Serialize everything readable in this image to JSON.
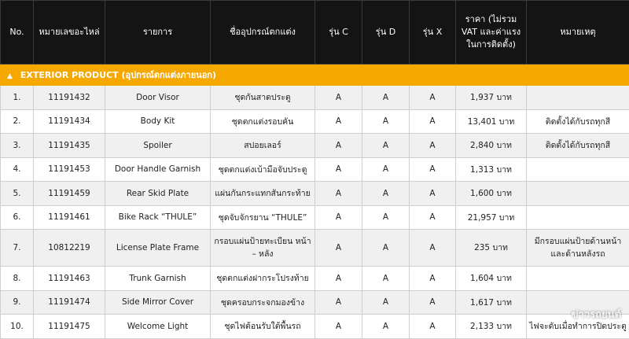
{
  "headers": {
    "no": "No.",
    "part_no": "หมายเลขอะไหล่",
    "item": "รายการ",
    "device": "ชื่ออุปกรณ์ตกแต่ง",
    "model_c": "รุ่น C",
    "model_d": "รุ่น D",
    "model_x": "รุ่น X",
    "price": "ราคา (ไม่รวม VAT และค่าแรง ในการติดตั้ง)",
    "note": "หมายเหตุ"
  },
  "section": {
    "icon": "triangle-up-icon",
    "title": "EXTERIOR PRODUCT (อุปกรณ์ตกแต่งภายนอก)"
  },
  "rows": [
    {
      "no": "1.",
      "part": "11191432",
      "item": "Door Visor",
      "device": "ชุดกันสาดประตู",
      "c": "A",
      "d": "A",
      "x": "A",
      "price": "1,937 บาท",
      "note": ""
    },
    {
      "no": "2.",
      "part": "11191434",
      "item": "Body Kit",
      "device": "ชุดตกแต่งรอบคัน",
      "c": "A",
      "d": "A",
      "x": "A",
      "price": "13,401 บาท",
      "note": "ติดตั้งได้กับรถทุกสี"
    },
    {
      "no": "3.",
      "part": "11191435",
      "item": "Spoiler",
      "device": "สปอยเลอร์",
      "c": "A",
      "d": "A",
      "x": "A",
      "price": "2,840 บาท",
      "note": "ติดตั้งได้กับรถทุกสี"
    },
    {
      "no": "4.",
      "part": "11191453",
      "item": "Door Handle Garnish",
      "device": "ชุดตกแต่งเบ้ามือจับประตู",
      "c": "A",
      "d": "A",
      "x": "A",
      "price": "1,313 บาท",
      "note": ""
    },
    {
      "no": "5.",
      "part": "11191459",
      "item": "Rear Skid Plate",
      "device": "แผ่นกันกระแทกสันกระท้าย",
      "c": "A",
      "d": "A",
      "x": "A",
      "price": "1,600 บาท",
      "note": ""
    },
    {
      "no": "6.",
      "part": "11191461",
      "item": "Bike Rack “THULE”",
      "device": "ชุดจับจักรยาน “THULE”",
      "c": "A",
      "d": "A",
      "x": "A",
      "price": "21,957 บาท",
      "note": ""
    },
    {
      "no": "7.",
      "part": "10812219",
      "item": "License Plate Frame",
      "device": "กรอบแผ่นป้ายทะเบียน หน้า – หลัง",
      "c": "A",
      "d": "A",
      "x": "A",
      "price": "235 บาท",
      "note": "มีกรอบแผ่นป้ายด้านหน้า และด้านหลังรถ"
    },
    {
      "no": "8.",
      "part": "11191463",
      "item": "Trunk Garnish",
      "device": "ชุดตกแต่งฝากระโปรงท้าย",
      "c": "A",
      "d": "A",
      "x": "A",
      "price": "1,604 บาท",
      "note": ""
    },
    {
      "no": "9.",
      "part": "11191474",
      "item": "Side Mirror Cover",
      "device": "ชุดครอบกระจกมองข้าง",
      "c": "A",
      "d": "A",
      "x": "A",
      "price": "1,617 บาท",
      "note": ""
    },
    {
      "no": "10.",
      "part": "11191475",
      "item": "Welcome Light",
      "device": "ชุดไฟต้อนรับใต้พื้นรถ",
      "c": "A",
      "d": "A",
      "x": "A",
      "price": "2,133 บาท",
      "note": "ไฟจะดับเมื่อทำการปิดประตู"
    }
  ],
  "watermark": "ข่าวรถยนต์"
}
